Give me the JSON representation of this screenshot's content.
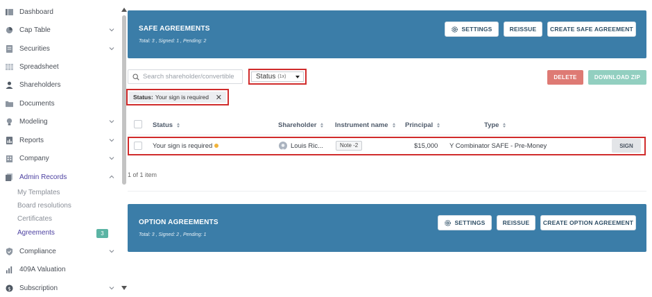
{
  "sidebar": {
    "items": [
      {
        "label": "Dashboard",
        "icon": "dashboard-icon"
      },
      {
        "label": "Cap Table",
        "icon": "pie-chart-icon"
      },
      {
        "label": "Securities",
        "icon": "certificate-icon"
      },
      {
        "label": "Spreadsheet",
        "icon": "spreadsheet-icon"
      },
      {
        "label": "Shareholders",
        "icon": "user-icon"
      },
      {
        "label": "Documents",
        "icon": "folder-icon"
      },
      {
        "label": "Modeling",
        "icon": "lightbulb-icon"
      },
      {
        "label": "Reports",
        "icon": "report-icon"
      },
      {
        "label": "Company",
        "icon": "building-icon"
      },
      {
        "label": "Admin Records",
        "icon": "admin-icon"
      },
      {
        "label": "Compliance",
        "icon": "shield-icon"
      },
      {
        "label": "409A Valuation",
        "icon": "valuation-icon"
      },
      {
        "label": "Subscription",
        "icon": "dollar-icon"
      }
    ],
    "admin_sub": [
      {
        "label": "My Templates"
      },
      {
        "label": "Board resolutions"
      },
      {
        "label": "Certificates"
      },
      {
        "label": "Agreements",
        "badge": "3"
      }
    ]
  },
  "safe": {
    "title": "SAFE AGREEMENTS",
    "summary": "Total: 3 , Signed: 1 , Pending: 2",
    "settings": "SETTINGS",
    "reissue": "REISSUE",
    "create": "CREATE SAFE AGREEMENT"
  },
  "toolbar": {
    "search_placeholder": "Search shareholder/convertible",
    "status_label": "Status",
    "status_count": "(1x)",
    "delete": "DELETE",
    "download_zip": "DOWNLOAD ZIP"
  },
  "filter": {
    "key": "Status:",
    "value": "Your sign is required"
  },
  "table": {
    "headers": {
      "status": "Status",
      "shareholder": "Shareholder",
      "instrument": "Instrument name",
      "principal": "Principal",
      "type": "Type"
    },
    "rows": [
      {
        "status": "Your sign is required",
        "shareholder": "Louis Ric...",
        "instrument": "Note -2",
        "principal": "$15,000",
        "type": "Y Combinator SAFE - Pre-Money",
        "action": "SIGN"
      }
    ],
    "pagination": "1 of 1 item"
  },
  "option": {
    "title": "OPTION AGREEMENTS",
    "summary": "Total: 3 , Signed: 2 , Pending: 1",
    "settings": "SETTINGS",
    "reissue": "REISSUE",
    "create": "CREATE OPTION AGREEMENT"
  },
  "colors": {
    "panel_blue": "#3b7da8",
    "accent_purple": "#4b3fa0",
    "delete_red": "#de7a74",
    "zip_teal": "#92cfc0",
    "badge_teal": "#5bb4a4",
    "highlight_red": "#d02b2b",
    "pending_orange": "#f0b33a"
  }
}
